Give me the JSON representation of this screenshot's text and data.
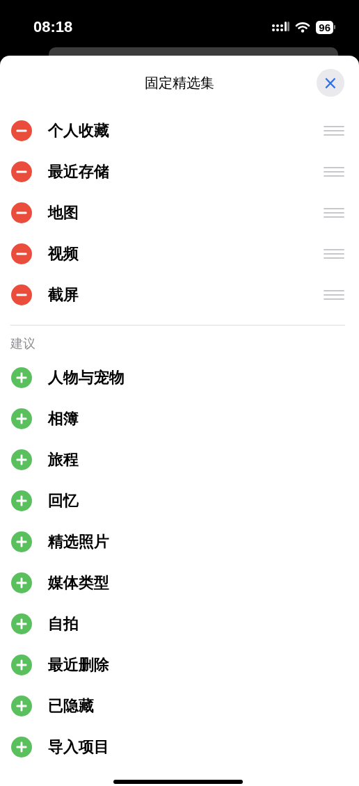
{
  "status_bar": {
    "time": "08:18",
    "battery": "96"
  },
  "sheet": {
    "title": "固定精选集",
    "close": "×"
  },
  "pinned": [
    {
      "label": "个人收藏"
    },
    {
      "label": "最近存储"
    },
    {
      "label": "地图"
    },
    {
      "label": "视频"
    },
    {
      "label": "截屏"
    }
  ],
  "suggestions": {
    "header": "建议",
    "items": [
      {
        "label": "人物与宠物"
      },
      {
        "label": "相簿"
      },
      {
        "label": "旅程"
      },
      {
        "label": "回忆"
      },
      {
        "label": "精选照片"
      },
      {
        "label": "媒体类型"
      },
      {
        "label": "自拍"
      },
      {
        "label": "最近删除"
      },
      {
        "label": "已隐藏"
      },
      {
        "label": "导入项目"
      }
    ]
  }
}
